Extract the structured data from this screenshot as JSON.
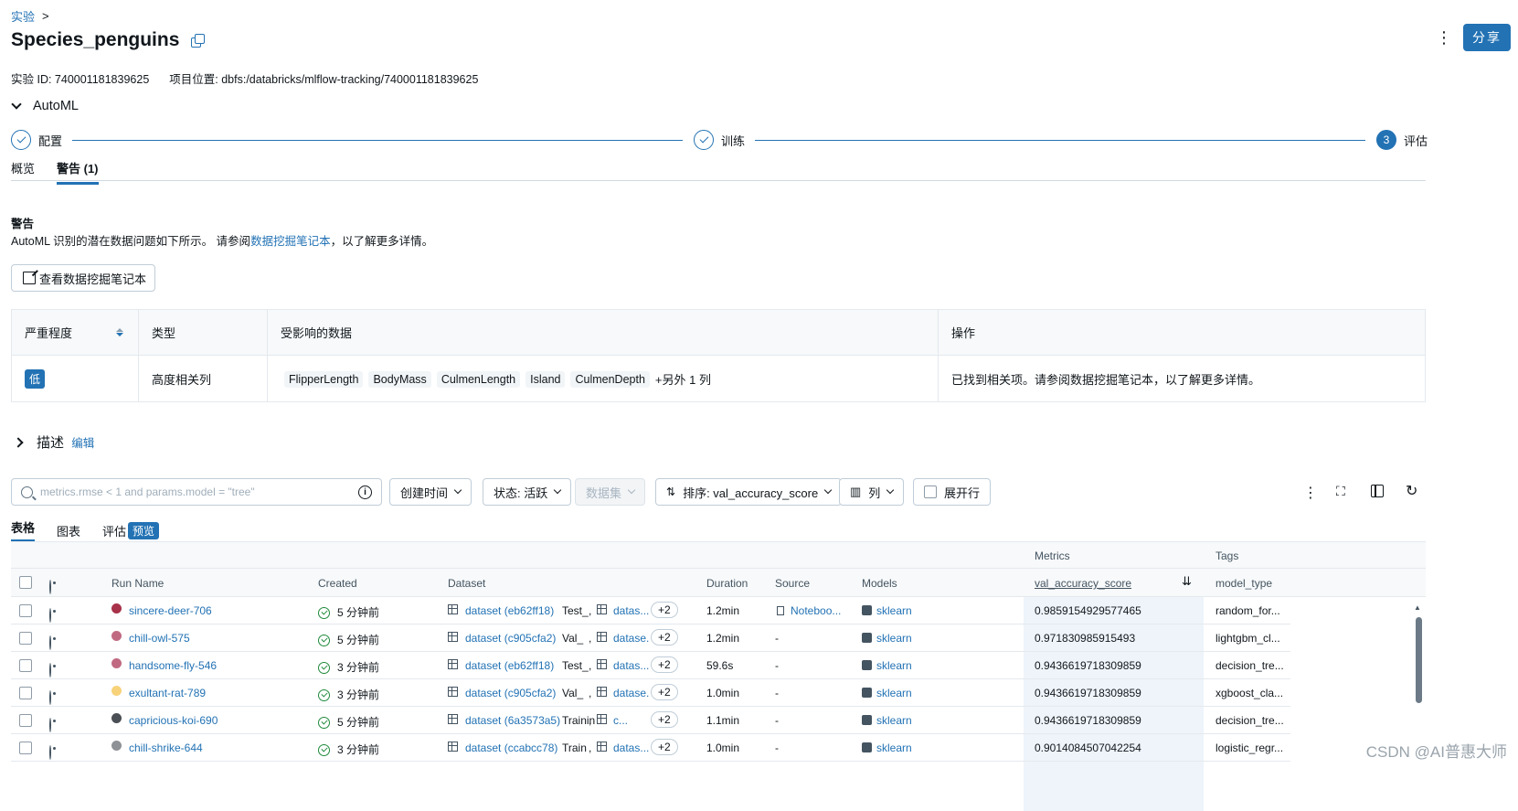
{
  "breadcrumb": {
    "root": "实验",
    "sep": ">"
  },
  "experiment": {
    "title": "Species_penguins",
    "id_label": "实验 ID: 740001181839625",
    "location_label": "项目位置: dbfs:/databricks/mlflow-tracking/740001181839625"
  },
  "header": {
    "share_label": "分享",
    "more": "⋮"
  },
  "automl": {
    "section_label": "AutoML",
    "steps": [
      {
        "label": "配置",
        "state": "done"
      },
      {
        "label": "训练",
        "state": "done"
      },
      {
        "number": "3",
        "label": "评估",
        "state": "current"
      }
    ],
    "tabs": [
      {
        "label": "概览",
        "active": false
      },
      {
        "label": "警告 (1)",
        "active": true
      }
    ]
  },
  "warnings": {
    "title": "警告",
    "desc_prefix": "AutoML 识别的潜在数据问题如下所示。 请参阅",
    "desc_link": "数据挖掘笔记本",
    "desc_suffix": "，以了解更多详情。",
    "notebook_button": "查看数据挖掘笔记本",
    "columns": [
      "严重程度",
      "类型",
      "受影响的数据",
      "操作"
    ],
    "rows": [
      {
        "severity": "低",
        "type": "高度相关列",
        "affected": [
          "FlipperLength",
          "BodyMass",
          "CulmenLength",
          "Island",
          "CulmenDepth"
        ],
        "more": "+另外 1 列",
        "action": "已找到相关项。请参阅数据挖掘笔记本，以了解更多详情。"
      }
    ]
  },
  "description": {
    "label": "描述",
    "edit": "编辑"
  },
  "filters": {
    "search_placeholder": "metrics.rmse < 1 and params.model = \"tree\"",
    "created": "创建时间",
    "state": "状态: 活跃",
    "dataset": "数据集",
    "sort": "排序: val_accuracy_score",
    "columns": "列",
    "expand_rows": "展开行"
  },
  "view_tabs": [
    {
      "label": "表格",
      "active": true
    },
    {
      "label": "图表",
      "active": false
    },
    {
      "label": "评估",
      "active": false
    }
  ],
  "preview_badge": "预览",
  "runs_table": {
    "groups": {
      "metrics": "Metrics",
      "tags": "Tags"
    },
    "headers": [
      "Run Name",
      "Created",
      "Dataset",
      "Duration",
      "Source",
      "Models",
      "val_accuracy_score",
      "model_type"
    ],
    "rows": [
      {
        "name": "sincere-deer-706",
        "color": "#a8324a",
        "created": "5 分钟前",
        "dataset": "dataset (eb62ff18)",
        "ctx": "Test_",
        "ds2": "datas...",
        "plus": "+2",
        "duration": "1.2min",
        "source": "Noteboo...",
        "model": "sklearn",
        "score": "0.9859154929577465",
        "model_type": "random_for..."
      },
      {
        "name": "chill-owl-575",
        "color": "#c06a82",
        "created": "5 分钟前",
        "dataset": "dataset (c905cfa2)",
        "ctx": "Val_",
        "ds2": "datase...",
        "plus": "+2",
        "duration": "1.2min",
        "source": "-",
        "model": "sklearn",
        "score": "0.971830985915493",
        "model_type": "lightgbm_cl..."
      },
      {
        "name": "handsome-fly-546",
        "color": "#c06a82",
        "created": "3 分钟前",
        "dataset": "dataset (eb62ff18)",
        "ctx": "Test_",
        "ds2": "datas...",
        "plus": "+2",
        "duration": "59.6s",
        "source": "-",
        "model": "sklearn",
        "score": "0.9436619718309859",
        "model_type": "decision_tre..."
      },
      {
        "name": "exultant-rat-789",
        "color": "#f7d27a",
        "created": "3 分钟前",
        "dataset": "dataset (c905cfa2)",
        "ctx": "Val_",
        "ds2": "datase...",
        "plus": "+2",
        "duration": "1.0min",
        "source": "-",
        "model": "sklearn",
        "score": "0.9436619718309859",
        "model_type": "xgboost_cla..."
      },
      {
        "name": "capricious-koi-690",
        "color": "#4a4f55",
        "created": "5 分钟前",
        "dataset": "dataset (6a3573a5)",
        "ctx": "Training_",
        "ds2": "c...",
        "plus": "+2",
        "duration": "1.1min",
        "source": "-",
        "model": "sklearn",
        "score": "0.9436619718309859",
        "model_type": "decision_tre..."
      },
      {
        "name": "chill-shrike-644",
        "color": "#8e9196",
        "created": "3 分钟前",
        "dataset": "dataset (ccabcc78)",
        "ctx": "Train",
        "ds2": "datas...",
        "plus": "+2",
        "duration": "1.0min",
        "source": "-",
        "model": "sklearn",
        "score": "0.9014084507042254",
        "model_type": "logistic_regr..."
      }
    ]
  },
  "watermark": "CSDN @AI普惠大师"
}
